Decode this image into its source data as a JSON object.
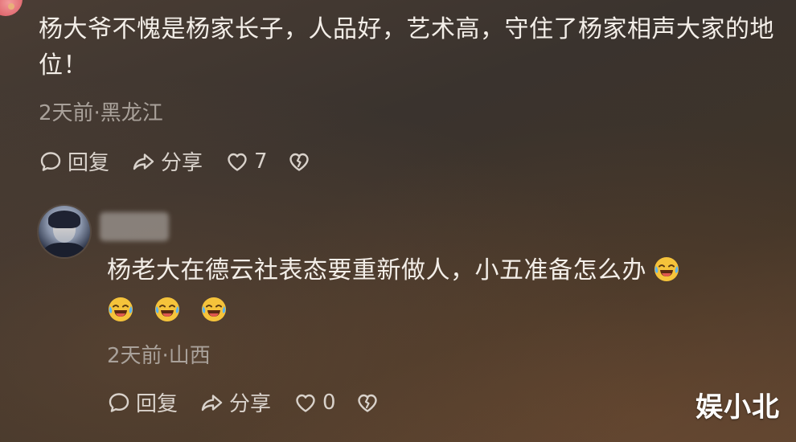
{
  "comments": [
    {
      "text": "杨大爷不愧是杨家长子，人品好，艺术高，守住了杨家相声大家的地位！",
      "meta": "2天前·黑龙江",
      "reply_label": "回复",
      "share_label": "分享",
      "like_count": "7"
    },
    {
      "text": "杨老大在德云社表态要重新做人，小五准备怎么办",
      "meta": "2天前·山西",
      "reply_label": "回复",
      "share_label": "分享",
      "like_count": "0",
      "emojis": [
        "crying-laughing-emoji",
        "crying-laughing-emoji",
        "crying-laughing-emoji",
        "crying-laughing-emoji"
      ]
    }
  ],
  "watermark": "娱小北",
  "colors": {
    "text": "#f3eee8",
    "meta": "#a9a19a",
    "emoji": "#f5c33b"
  }
}
